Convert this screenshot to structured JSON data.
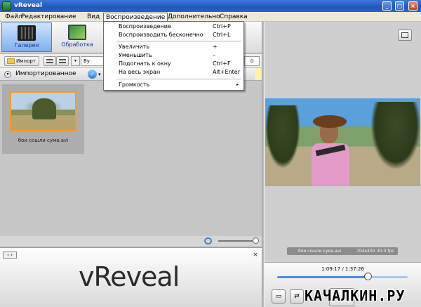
{
  "window": {
    "title": "vReveal",
    "minimize": "_",
    "maximize": "□",
    "close": "×"
  },
  "menu": {
    "items": [
      "Файл",
      "Редактирование",
      "Вид",
      "Воспроизведение",
      "Дополнительно",
      "Справка"
    ],
    "open_menu": "Воспроизведение"
  },
  "dropdown": {
    "items": [
      {
        "label": "Воспроизведение",
        "shortcut": "Ctrl+P"
      },
      {
        "label": "Воспроизводить бесконечно",
        "shortcut": "Ctrl+L"
      },
      {
        "label": "Увеличить",
        "shortcut": "+"
      },
      {
        "label": "Уменьшить",
        "shortcut": "–"
      },
      {
        "label": "Подогнать к окну",
        "shortcut": "Ctrl+F"
      },
      {
        "label": "На весь экран",
        "shortcut": "Alt+Enter"
      },
      {
        "label": "Громкость",
        "submenu": "▸"
      }
    ]
  },
  "toolbar": {
    "gallery_label": "Галерея",
    "edit_label": "Обработка"
  },
  "subbar": {
    "import_label": "Импорт",
    "sort_label": "By Name",
    "sort_arrow": "▾",
    "search_glyph": "⊙"
  },
  "group": {
    "title": "Импортированное",
    "collapse_glyph": "▾",
    "check_glyph": "✓",
    "select_glyph": "▾"
  },
  "gallery": {
    "items": [
      {
        "label": "бои сошли сума.avi"
      }
    ]
  },
  "bottom_panel": {
    "nav": "‹ ›",
    "close": "×",
    "logo": "vReveal"
  },
  "preview": {
    "info_name": "бои сошли сума.avi",
    "info_res": "704x400",
    "info_fps": "30.0 fps",
    "timecode": "1:09:17 / 1:37:26",
    "progress_fraction": 0.7,
    "ctrl_left": "▭",
    "ctrl_right": "⇄"
  },
  "watermark": {
    "text": "КАЧАЛКИН.РУ"
  }
}
